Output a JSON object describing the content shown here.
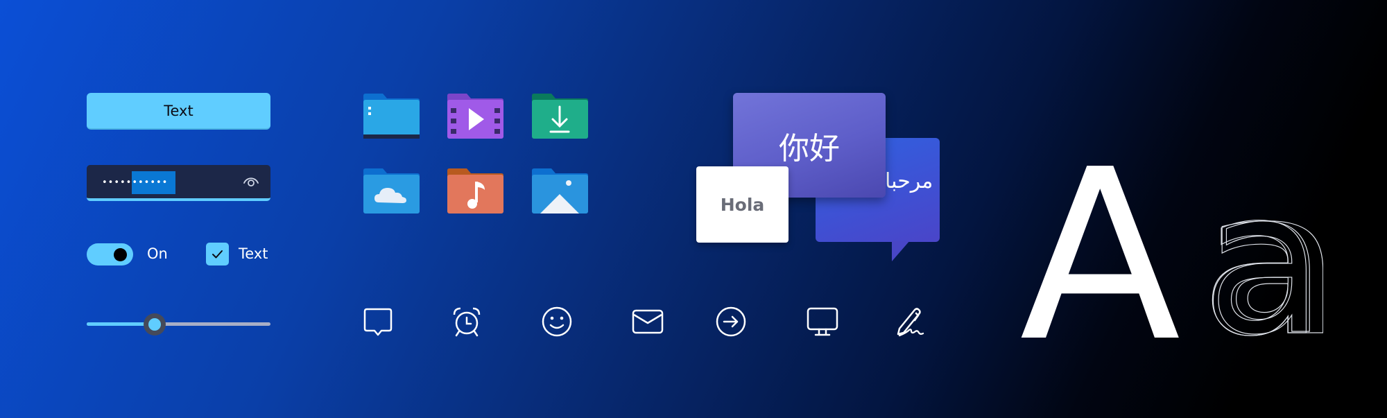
{
  "theme": {
    "accent": "#60cdff",
    "background_gradient": [
      "#0b4fd6",
      "#07286f",
      "#000000"
    ]
  },
  "controls": {
    "button": {
      "label": "Text"
    },
    "password": {
      "masked_value": "•••••••••••",
      "reveal_icon": "eye-icon"
    },
    "toggle": {
      "state": "on",
      "label": "On"
    },
    "checkbox": {
      "checked": true,
      "label": "Text"
    },
    "slider": {
      "value_percent": 37
    }
  },
  "folders": [
    {
      "name": "documents-folder",
      "color": "#2aa7e6",
      "glyph": "document"
    },
    {
      "name": "videos-folder",
      "color": "#9b56e6",
      "glyph": "play"
    },
    {
      "name": "downloads-folder",
      "color": "#1fae8a",
      "glyph": "download-arrow"
    },
    {
      "name": "onedrive-folder",
      "color": "#2a9be2",
      "glyph": "cloud"
    },
    {
      "name": "music-folder",
      "color": "#e2775c",
      "glyph": "music-note"
    },
    {
      "name": "pictures-folder",
      "color": "#2a94de",
      "glyph": "mountain"
    }
  ],
  "greetings": {
    "chinese": "你好",
    "arabic": "مرحبا",
    "spanish": "Hola"
  },
  "icons": [
    "chat-bubble-icon",
    "alarm-clock-icon",
    "smiley-icon",
    "mail-icon",
    "arrow-circle-right-icon",
    "monitor-icon",
    "pen-signature-icon"
  ],
  "typography": {
    "upper": "A",
    "lower": "a"
  }
}
